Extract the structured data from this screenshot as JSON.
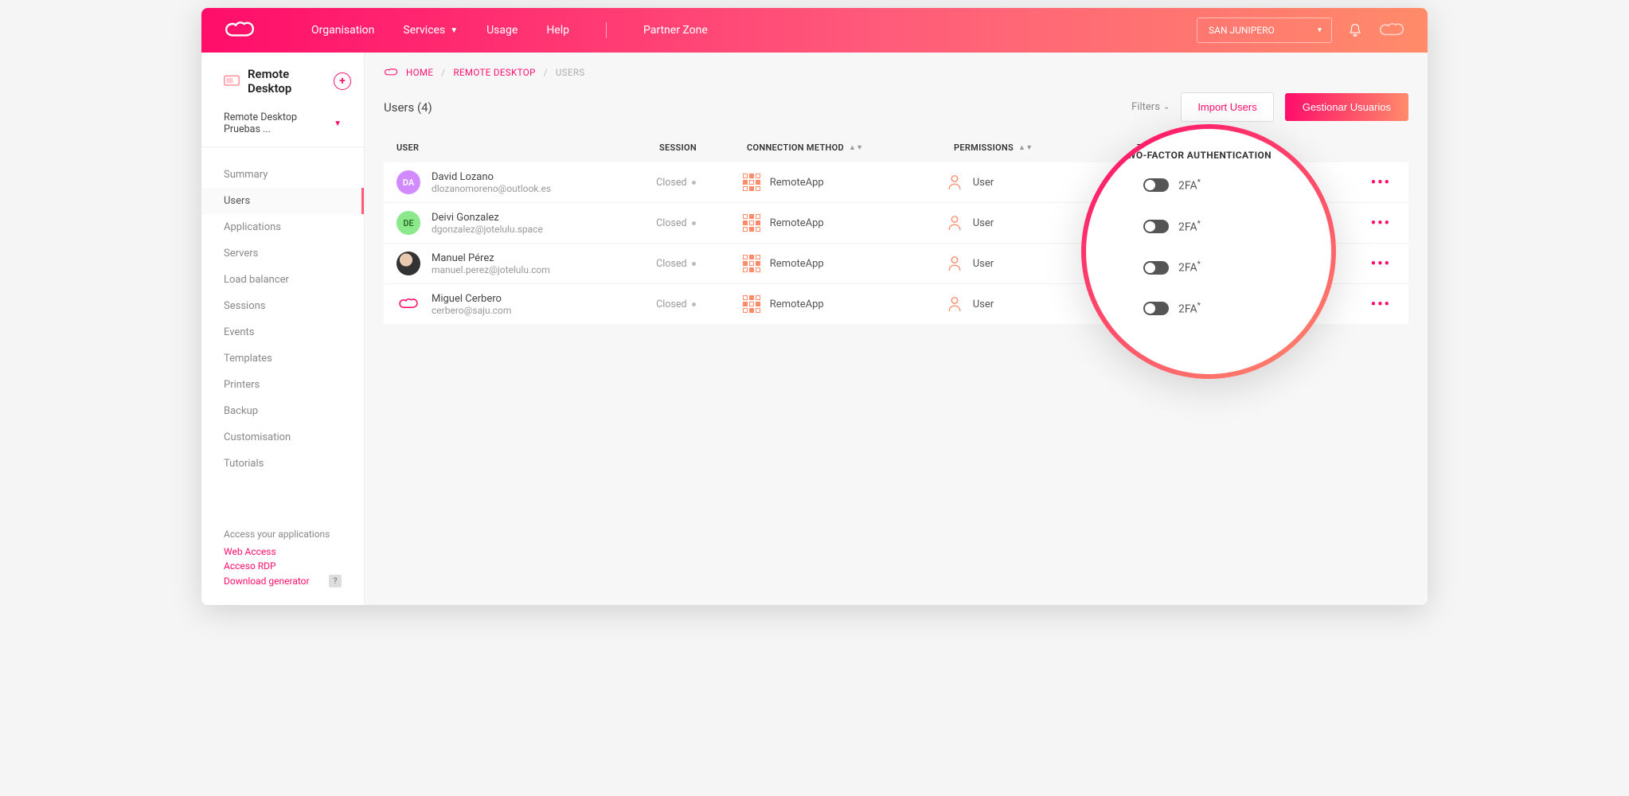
{
  "topnav": {
    "items": [
      "Organisation",
      "Services",
      "Usage",
      "Help"
    ],
    "partner": "Partner Zone",
    "org_selected": "SAN JUNIPERO"
  },
  "sidebar": {
    "title": "Remote Desktop",
    "subtitle": "Remote Desktop Pruebas ...",
    "items": [
      "Summary",
      "Users",
      "Applications",
      "Servers",
      "Load balancer",
      "Sessions",
      "Events",
      "Templates",
      "Printers",
      "Backup",
      "Customisation",
      "Tutorials"
    ],
    "active_index": 1,
    "footer_header": "Access your applications",
    "footer_links": [
      "Web Access",
      "Acceso RDP",
      "Download generator"
    ]
  },
  "breadcrumb": {
    "home": "HOME",
    "mid": "REMOTE DESKTOP",
    "current": "USERS"
  },
  "page": {
    "title": "Users (4)",
    "filters_label": "Filters",
    "import_label": "Import Users",
    "manage_label": "Gestionar Usuarios"
  },
  "table": {
    "headers": {
      "user": "USER",
      "session": "SESSION",
      "connection": "CONNECTION METHOD",
      "permissions": "PERMISSIONS",
      "tfa": "TWO-FACTOR AUTHENTICATION"
    },
    "rows": [
      {
        "initials": "DA",
        "name": "David Lozano",
        "email": "dlozanomoreno@outlook.es",
        "session": "Closed",
        "connection": "RemoteApp",
        "permission": "User",
        "tfa": "2FA"
      },
      {
        "initials": "DE",
        "name": "Deivi Gonzalez",
        "email": "dgonzalez@jotelulu.space",
        "session": "Closed",
        "connection": "RemoteApp",
        "permission": "User",
        "tfa": "2FA"
      },
      {
        "initials": "",
        "name": "Manuel Pérez",
        "email": "manuel.perez@jotelulu.com",
        "session": "Closed",
        "connection": "RemoteApp",
        "permission": "User",
        "tfa": "2FA"
      },
      {
        "initials": "",
        "name": "Miguel Cerbero",
        "email": "cerbero@saju.com",
        "session": "Closed",
        "connection": "RemoteApp",
        "permission": "User",
        "tfa": "2FA"
      }
    ]
  },
  "highlight": {
    "title": "TWO-FACTOR AUTHENTICATION",
    "rows": [
      "2FA",
      "2FA",
      "2FA",
      "2FA"
    ]
  }
}
